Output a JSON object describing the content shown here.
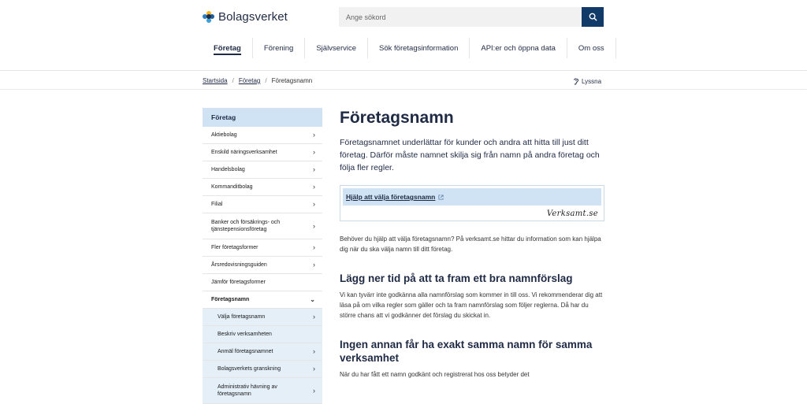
{
  "brand": {
    "name": "Bolagsverket"
  },
  "search": {
    "placeholder": "Ange sökord"
  },
  "nav": [
    "Företag",
    "Förening",
    "Självservice",
    "Sök företagsinformation",
    "API:er och öppna data",
    "Om oss"
  ],
  "breadcrumb": [
    "Startsida",
    "Företag",
    "Företagsnamn"
  ],
  "listen": "Lyssna",
  "sidenav": {
    "heading": "Företag",
    "items": [
      "Aktiebolag",
      "Enskild näringsverksamhet",
      "Handelsbolag",
      "Kommanditbolag",
      "Filial",
      "Banker och försäkrings- och tjänstepensionsföretag",
      "Fler företagsformer",
      "Årsredovisningsguiden",
      "Jämför företagsformer",
      "Företagsnamn",
      "Välja företagsnamn",
      "Beskriv verksamheten",
      "Anmäl företagsnamnet",
      "Bolagsverkets granskning",
      "Administrativ hävning av företagsnamn"
    ]
  },
  "content": {
    "title": "Företagsnamn",
    "ingress": "Företagsnamnet underlättar för kunder och andra att hitta till just ditt företag. Därför måste namnet skilja sig från namn på andra företag och följa fler regler.",
    "promo_link": "Hjälp att välja företagsnamn",
    "promo_brand": "Verksamt.se",
    "p1": "Behöver du hjälp att välja företagsnamn? På verksamt.se hittar du information som kan hjälpa dig när du ska välja namn till ditt företag.",
    "h2a": "Lägg ner tid på att ta fram ett bra namnförslag",
    "p2": "Vi kan tyvärr inte godkänna alla namnförslag som kommer in till oss. Vi rekommenderar dig att läsa på om vilka regler som gäller och ta fram namnförslag som följer reglerna. Då har du större chans att vi godkänner det förslag du skickat in.",
    "h2b": "Ingen annan får ha exakt samma namn för samma verksamhet",
    "p3": "När du har fått ett namn godkänt och registrerat hos oss betyder det"
  }
}
